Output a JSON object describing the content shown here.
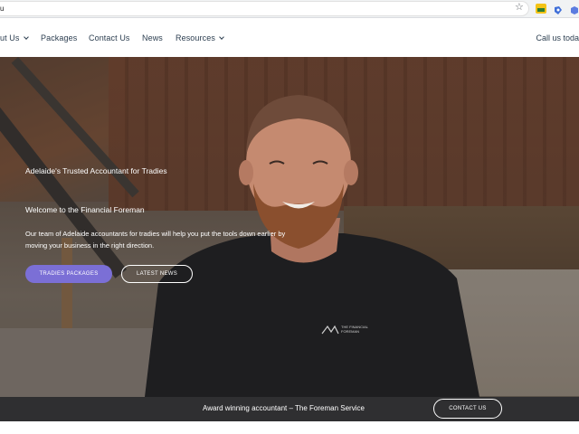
{
  "browser": {
    "address_text": "u",
    "star_icon": "star-icon",
    "extensions": [
      "extension-icon",
      "extension-icon",
      "extension-icon"
    ]
  },
  "nav": {
    "items": [
      {
        "label": "ut Us",
        "has_dropdown": true
      },
      {
        "label": "Packages",
        "has_dropdown": false
      },
      {
        "label": "Contact Us",
        "has_dropdown": false
      },
      {
        "label": "News",
        "has_dropdown": false
      },
      {
        "label": "Resources",
        "has_dropdown": true
      }
    ],
    "call_text": "Call us toda"
  },
  "hero": {
    "subtitle": "Adelaide's Trusted Accountant for Tradies",
    "title": "Welcome to the Financial Foreman",
    "body": "Our team of Adelaide accountants for tradies will help you put the tools down earlier by moving your business in the right direction.",
    "primary_button": "TRADIES PACKAGES",
    "secondary_button": "LATEST NEWS",
    "shirt_logo": "THE FINANCIAL FOREMAN"
  },
  "strip": {
    "text": "Award winning accountant – The Foreman Service",
    "button": "CONTACT US"
  },
  "colors": {
    "accent": "#7b6fd6",
    "nav_text": "#2c3e50",
    "strip_bg": "#2f2f31"
  }
}
